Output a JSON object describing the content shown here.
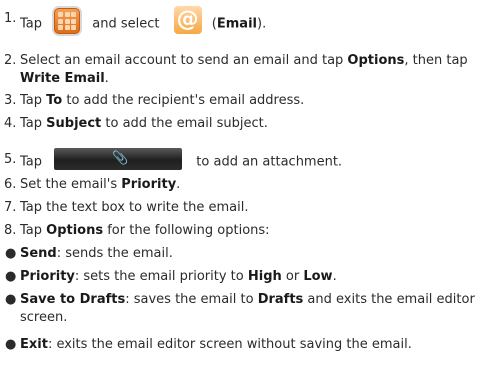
{
  "steps": [
    {
      "num": "1.",
      "t1": "Tap",
      "t2": "and select",
      "t3": "(",
      "b1": "Email",
      "t4": ")."
    },
    {
      "num": "2.",
      "t1": "Select an email account to send an email and tap ",
      "b1": "Options",
      "t2": ", then tap ",
      "b2": "Write Email",
      "t3": "."
    },
    {
      "num": "3.",
      "t1": "Tap ",
      "b1": "To",
      "t2": " to add the recipient's email address."
    },
    {
      "num": "4.",
      "t1": "Tap ",
      "b1": "Subject",
      "t2": " to add the email subject."
    },
    {
      "num": "5.",
      "t1": "Tap",
      "t2": "to add an attachment."
    },
    {
      "num": "6.",
      "t1": "Set the email's ",
      "b1": "Priority",
      "t2": "."
    },
    {
      "num": "7.",
      "t1": "Tap the text box to write the email."
    },
    {
      "num": "8.",
      "t1": "Tap ",
      "b1": "Options",
      "t2": " for the following options:"
    }
  ],
  "options": [
    {
      "b1": "Send",
      "t1": ": sends the email."
    },
    {
      "b1": "Priority",
      "t1": ": sets the email priority to ",
      "b2": "High",
      "t2": " or ",
      "b3": "Low",
      "t3": "."
    },
    {
      "b1": "Save to Drafts",
      "t1": ": saves the email to ",
      "b2": "Drafts",
      "t2": " and exits the email editor screen."
    },
    {
      "b1": "Exit",
      "t1": ": exits the email editor screen without saving the email."
    }
  ],
  "icons": {
    "menu": "app-grid-icon",
    "email": "email-at-icon",
    "attach": "paperclip-icon"
  },
  "colors": {
    "menu_icon": "#e8801e",
    "email_icon": "#f6a744",
    "attach_bar": "#2c2c2c"
  }
}
